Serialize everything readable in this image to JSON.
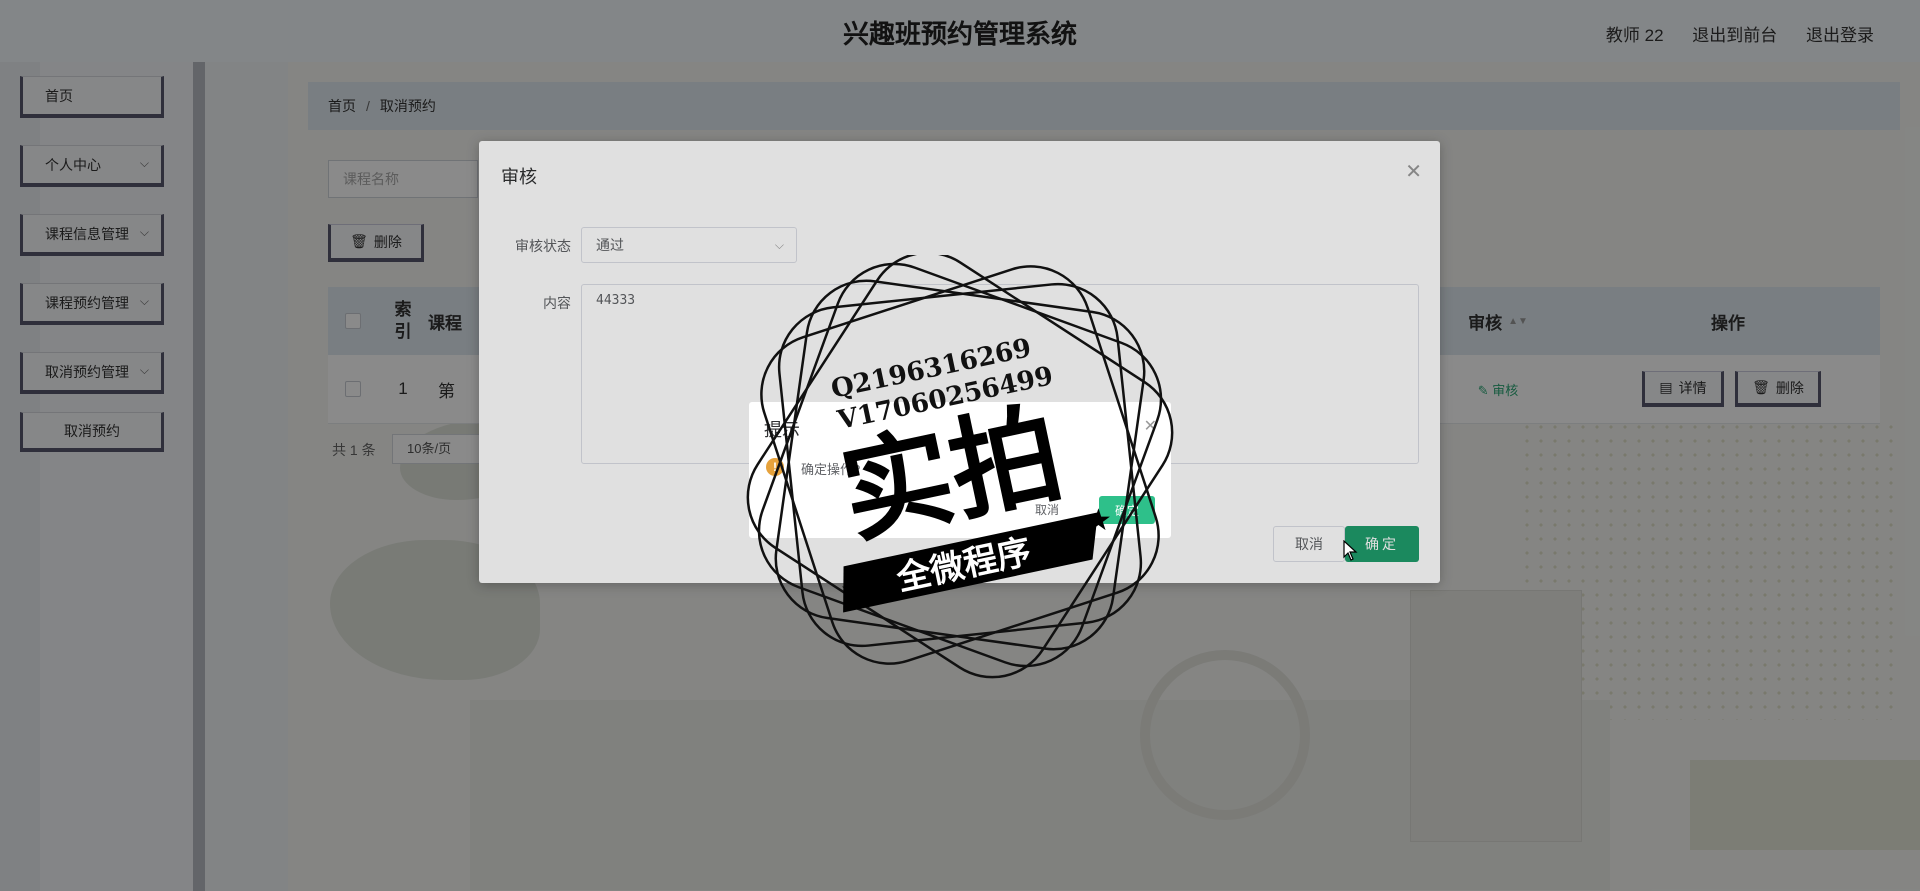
{
  "header": {
    "title": "兴趣班预约管理系统",
    "links": [
      "教师 22",
      "退出到前台",
      "退出登录"
    ]
  },
  "sidebar": {
    "items": [
      {
        "label": "首页",
        "has_children": false
      },
      {
        "label": "个人中心",
        "has_children": true
      },
      {
        "label": "课程信息管理",
        "has_children": true
      },
      {
        "label": "课程预约管理",
        "has_children": true
      },
      {
        "label": "取消预约管理",
        "has_children": true
      }
    ],
    "active_subitem": "取消预约"
  },
  "breadcrumb": {
    "home": "首页",
    "separator": "/",
    "current": "取消预约"
  },
  "search": {
    "placeholder": "课程名称"
  },
  "toolbar": {
    "delete_label": "删除"
  },
  "table": {
    "headers": {
      "index": "索\n引",
      "course": "课程",
      "audit": "审核",
      "actions": "操作"
    },
    "rows": [
      {
        "index": "1",
        "course": "第",
        "audit_link": "审核",
        "detail_label": "详情",
        "delete_label": "删除"
      }
    ]
  },
  "pager": {
    "total": "共 1 条",
    "page_size": "10条/页"
  },
  "audit_dialog": {
    "title": "审核",
    "status_label": "审核状态",
    "status_value": "通过",
    "content_label": "内容",
    "content_value": "44333",
    "cancel_label": "取消",
    "ok_label": "确定"
  },
  "confirm_dialog": {
    "title": "提示",
    "message": "确定操作?",
    "cancel_label": "取消",
    "ok_label": "确定"
  },
  "watermark": {
    "line1": "Q2196316269",
    "line2": "V17060256499",
    "big_text": "实拍",
    "ribbon_text": "全微程序"
  },
  "colors": {
    "accent_green": "#1f9c6b",
    "confirm_green": "#2ec08a",
    "warning": "#e6a23c",
    "menu_border": "#58586e"
  }
}
